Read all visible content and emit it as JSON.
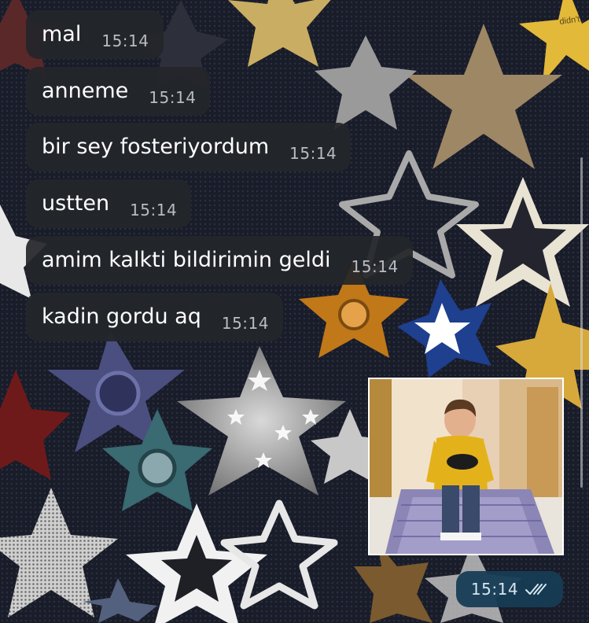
{
  "chat": {
    "incoming": [
      {
        "text": "mal",
        "time": "15:14"
      },
      {
        "text": "anneme",
        "time": "15:14"
      },
      {
        "text": "bir sey fosteriyordum",
        "time": "15:14"
      },
      {
        "text": "ustten",
        "time": "15:14"
      },
      {
        "text": "amim kalkti bildirimin geldi",
        "time": "15:14"
      },
      {
        "text": "kadin gordu aq",
        "time": "15:14"
      }
    ],
    "outgoing": {
      "media": "photo-message",
      "time": "15:14",
      "status_icon": "double-check-icon"
    }
  },
  "wallpaper": {
    "theme": "stars-collage",
    "corner_text": "didn't"
  },
  "colors": {
    "incoming_bubble": "#24262a",
    "outgoing_bubble": "#163c54",
    "timestamp_incoming": "#b9bcc3",
    "timestamp_outgoing": "#d6e6f0"
  }
}
